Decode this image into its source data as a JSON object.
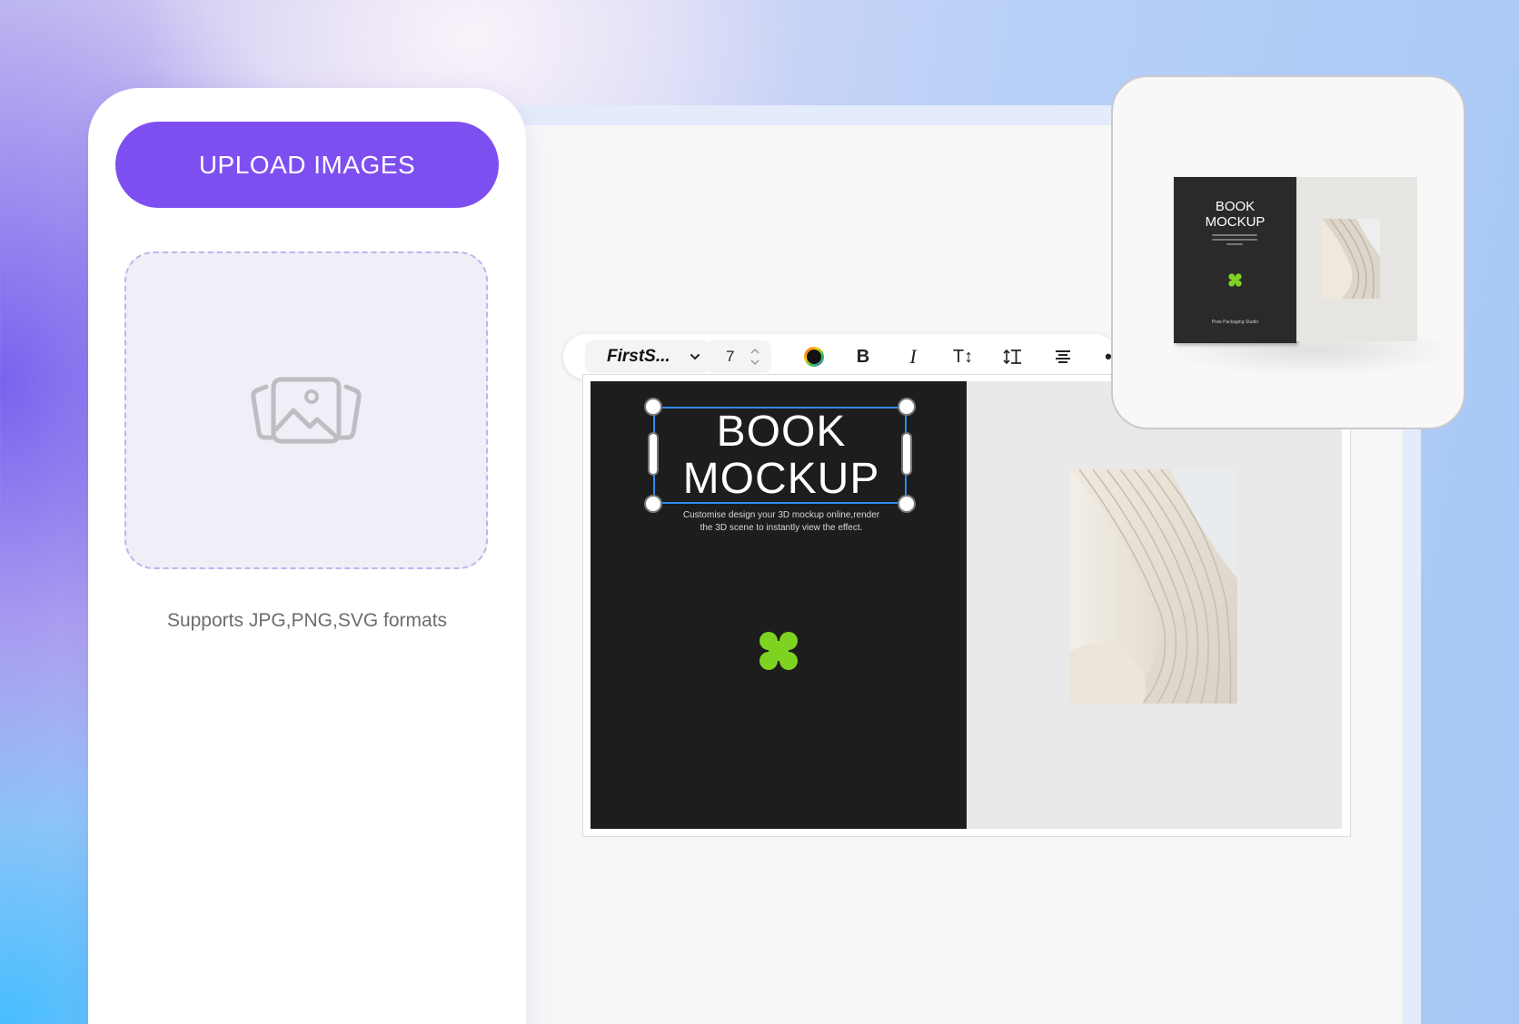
{
  "upload_panel": {
    "upload_button_label": "UPLOAD IMAGES",
    "dropzone_icon": "images-icon",
    "formats_note": "Supports JPG,PNG,SVG formats"
  },
  "toolbar": {
    "font_name": "FirstS...",
    "font_size": "7",
    "color_icon": "color-wheel-icon",
    "bold_label": "B",
    "italic_label": "I",
    "text_size_icon": "T↕",
    "line_height_icon": "line-height-icon",
    "align_icon": "align-center-icon",
    "more_label": "•"
  },
  "book": {
    "title_line1": "BOOK",
    "title_line2": "MOCKUP",
    "description": "Customise design your 3D mockup online,render the 3D scene to instantly view the effect.",
    "logo_color": "#7ed321"
  },
  "preview": {
    "title_line1": "BOOK",
    "title_line2": "MOCKUP",
    "footer": "Pixie Packaging Studio"
  },
  "colors": {
    "accent": "#7e4ff0",
    "selection": "#2d8cf0",
    "cover": "#1d1d1d"
  }
}
